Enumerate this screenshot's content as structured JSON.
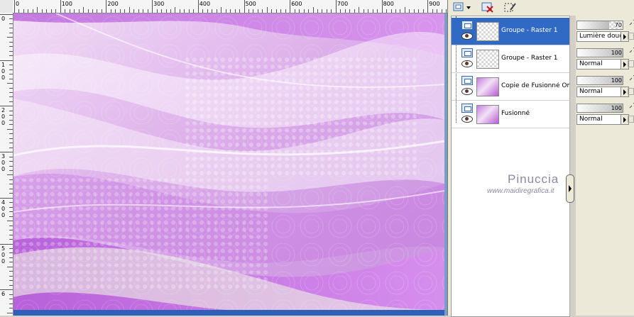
{
  "ruler": {
    "top_labels": [
      "0",
      "100",
      "200",
      "300",
      "400",
      "500",
      "600",
      "700",
      "800",
      "900"
    ],
    "left_labels": [
      [
        "0"
      ],
      [
        "1",
        "0",
        "0"
      ],
      [
        "2",
        "0",
        "0"
      ],
      [
        "3",
        "0",
        "0"
      ],
      [
        "4",
        "0",
        "0"
      ],
      [
        "5",
        "0",
        "0"
      ],
      [
        "6"
      ]
    ]
  },
  "layers": [
    {
      "name": "Groupe - Raster 1",
      "selected": true,
      "thumb": "checker"
    },
    {
      "name": "Groupe - Raster 1",
      "selected": false,
      "thumb": "checker"
    },
    {
      "name": "Copie de Fusionné Om",
      "selected": false,
      "thumb": "image"
    },
    {
      "name": "Fusionné",
      "selected": false,
      "thumb": "image"
    }
  ],
  "props": [
    {
      "opacity": "70",
      "blend": "Lumière douce",
      "opacity_fraction": 0.7
    },
    {
      "opacity": "100",
      "blend": "Normal",
      "opacity_fraction": 1.0
    },
    {
      "opacity": "100",
      "blend": "Normal",
      "opacity_fraction": 1.0
    },
    {
      "opacity": "100",
      "blend": "Normal",
      "opacity_fraction": 1.0
    }
  ],
  "toolbar": {
    "icons": [
      "new-layer-icon",
      "delete-layer-icon",
      "selection-brush-icon"
    ]
  },
  "watermark": {
    "name": "Pinuccia",
    "url": "www.maidiregrafica.it"
  },
  "colors": {
    "selected": "#316ac5",
    "canvas_base": "#e9c5ef",
    "purple": "#b65ad8"
  }
}
